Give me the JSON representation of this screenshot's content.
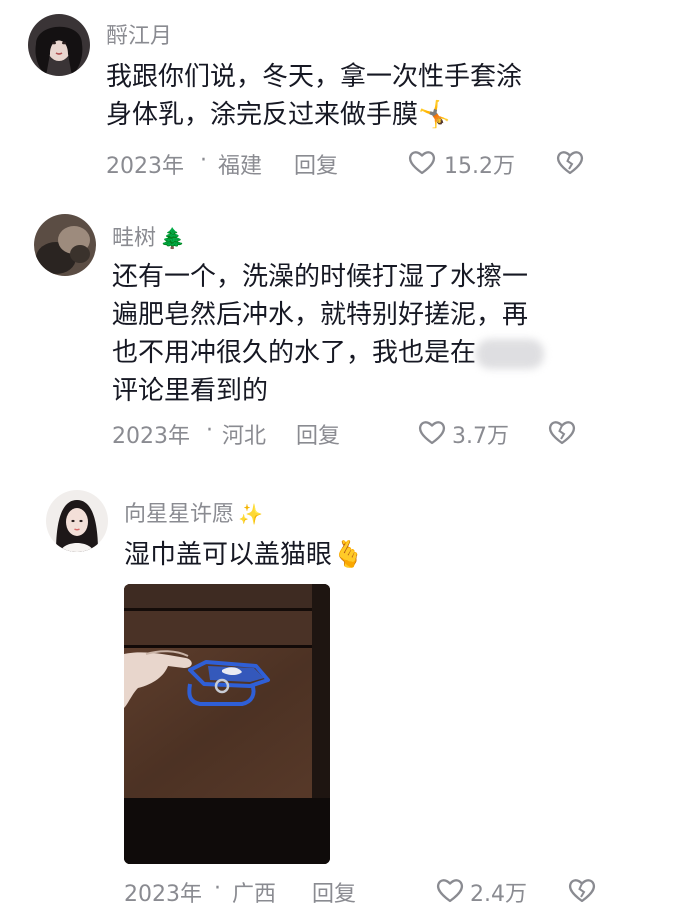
{
  "comments": [
    {
      "username": "酹江月",
      "username_emoji": "",
      "lines": [
        "我跟你们说，冬天，拿一次性手套涂",
        "身体乳，涂完反过来做手膜"
      ],
      "inline_emoji": "🤸",
      "year": "2023年",
      "dot": "·",
      "location": "福建",
      "reply_label": "回复",
      "likes": "15.2万"
    },
    {
      "username": "畦树",
      "username_emoji": "🌲",
      "lines": [
        "还有一个，洗澡的时候打湿了水擦一",
        "遍肥皂然后冲水，就特别好搓泥，再",
        "也不用冲很久的水了，我也是在",
        "评论里看到的"
      ],
      "year": "2023年",
      "dot": "·",
      "location": "河北",
      "reply_label": "回复",
      "likes": "3.7万"
    },
    {
      "username": "向星星许愿",
      "username_emoji": "✨",
      "lines": [
        "湿巾盖可以盖猫眼"
      ],
      "inline_emoji": "🫰",
      "year": "2023年",
      "dot": "·",
      "location": "广西",
      "reply_label": "回复",
      "likes": "2.4万"
    }
  ],
  "icons": {
    "like": "heart-outline-icon",
    "dislike": "broken-heart-icon"
  },
  "colors": {
    "text": "#161823",
    "muted": "#8a8b91",
    "lid_blue": "#2f5fd6"
  }
}
